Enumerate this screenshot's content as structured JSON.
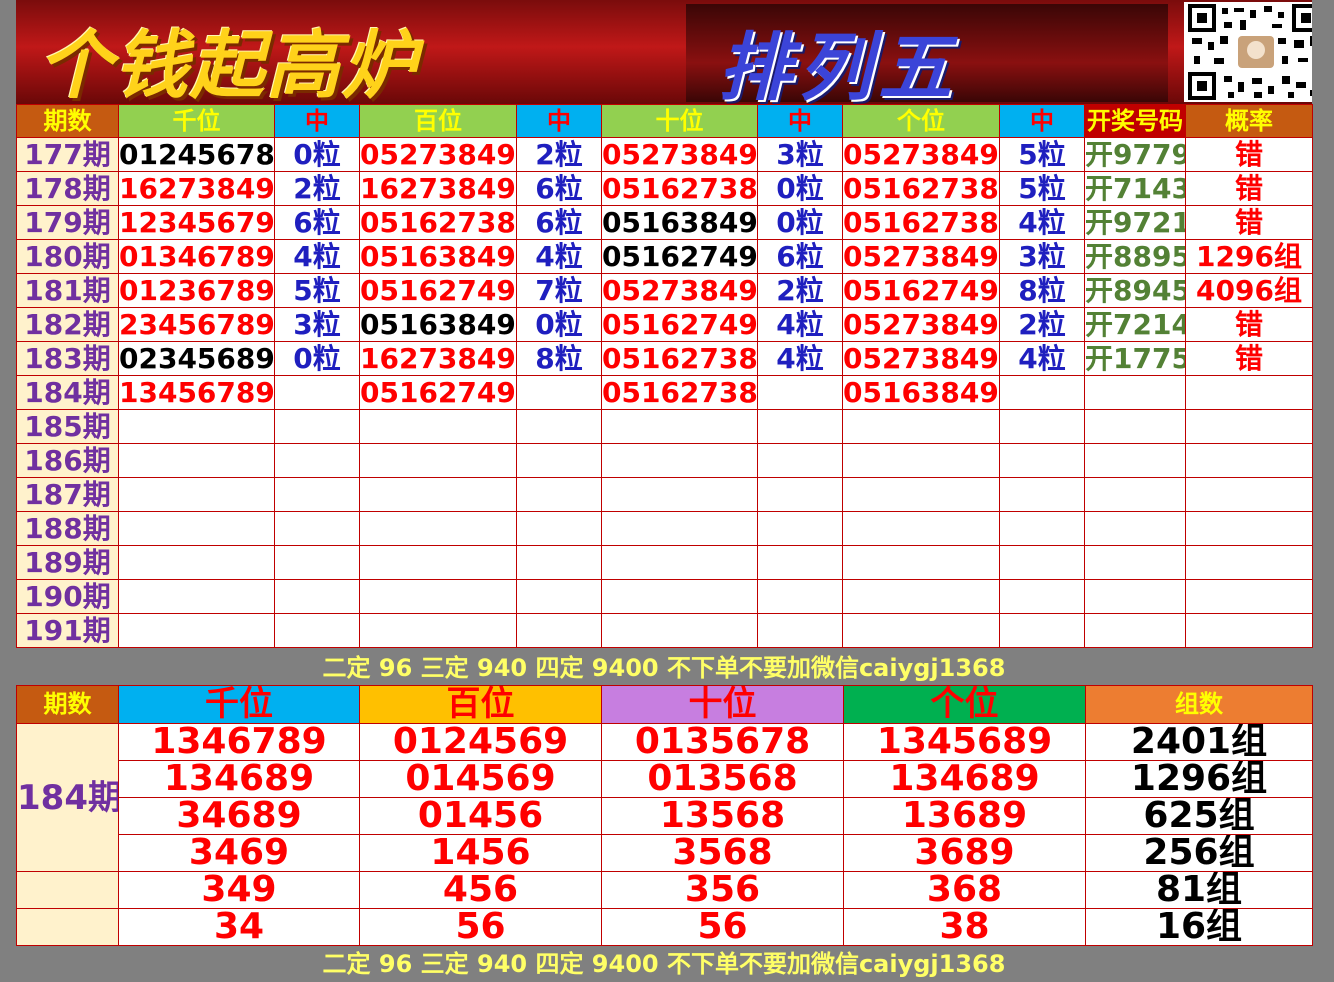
{
  "banner": {
    "title_left": "个钱起高炉",
    "title_right": "排列五",
    "qr_name": "wechat-qr-code"
  },
  "table1": {
    "headers": [
      "期数",
      "千位",
      "中",
      "百位",
      "中",
      "十位",
      "中",
      "个位",
      "中",
      "开奖号码",
      "概率"
    ],
    "rows": [
      {
        "period": "177期",
        "q": "01245678",
        "q_hit": "0粒",
        "b": "05273849",
        "b_hit": "2粒",
        "s": "05273849",
        "s_hit": "3粒",
        "g": "05273849",
        "g_hit": "5粒",
        "draw": "开9779",
        "rate": "错"
      },
      {
        "period": "178期",
        "q": "16273849",
        "q_hit": "2粒",
        "b": "16273849",
        "b_hit": "6粒",
        "s": "05162738",
        "s_hit": "0粒",
        "g": "05162738",
        "g_hit": "5粒",
        "draw": "开7143",
        "rate": "错"
      },
      {
        "period": "179期",
        "q": "12345679",
        "q_hit": "6粒",
        "b": "05162738",
        "b_hit": "6粒",
        "s": "05163849",
        "s_hit": "0粒",
        "g": "05162738",
        "g_hit": "4粒",
        "draw": "开9721",
        "rate": "错"
      },
      {
        "period": "180期",
        "q": "01346789",
        "q_hit": "4粒",
        "b": "05163849",
        "b_hit": "4粒",
        "s": "05162749",
        "s_hit": "6粒",
        "g": "05273849",
        "g_hit": "3粒",
        "draw": "开8895",
        "rate": "1296组"
      },
      {
        "period": "181期",
        "q": "01236789",
        "q_hit": "5粒",
        "b": "05162749",
        "b_hit": "7粒",
        "s": "05273849",
        "s_hit": "2粒",
        "g": "05162749",
        "g_hit": "8粒",
        "draw": "开8945",
        "rate": "4096组"
      },
      {
        "period": "182期",
        "q": "23456789",
        "q_hit": "3粒",
        "b": "05163849",
        "b_hit": "0粒",
        "s": "05162749",
        "s_hit": "4粒",
        "g": "05273849",
        "g_hit": "2粒",
        "draw": "开7214",
        "rate": "错"
      },
      {
        "period": "183期",
        "q": "02345689",
        "q_hit": "0粒",
        "b": "16273849",
        "b_hit": "8粒",
        "s": "05162738",
        "s_hit": "4粒",
        "g": "05273849",
        "g_hit": "4粒",
        "draw": "开1775",
        "rate": "错"
      },
      {
        "period": "184期",
        "q": "13456789",
        "q_hit": "",
        "b": "05162749",
        "b_hit": "",
        "s": "05162738",
        "s_hit": "",
        "g": "05163849",
        "g_hit": "",
        "draw": "",
        "rate": ""
      },
      {
        "period": "185期"
      },
      {
        "period": "186期"
      },
      {
        "period": "187期"
      },
      {
        "period": "188期"
      },
      {
        "period": "189期"
      },
      {
        "period": "190期"
      },
      {
        "period": "191期"
      }
    ]
  },
  "notice": "二定 96 三定 940 四定 9400 不下单不要加微信caiygj1368",
  "table2": {
    "headers": [
      "期数",
      "千位",
      "百位",
      "十位",
      "个位",
      "组数"
    ],
    "period": "184期",
    "rows": [
      [
        "1346789",
        "0124569",
        "0135678",
        "1345689",
        "2401组"
      ],
      [
        "134689",
        "014569",
        "013568",
        "134689",
        "1296组"
      ],
      [
        "34689",
        "01456",
        "13568",
        "13689",
        "625组"
      ],
      [
        "3469",
        "1456",
        "3568",
        "3689",
        "256组"
      ],
      [
        "349",
        "456",
        "356",
        "368",
        "81组"
      ],
      [
        "34",
        "56",
        "56",
        "38",
        "16组"
      ]
    ]
  },
  "colors": {
    "header_green": "#92d050",
    "header_blue": "#00b0f0",
    "red": "#ff0000",
    "hit_blue": "#1f1fbf",
    "draw_green": "#538135",
    "period_purple": "#7030a0"
  }
}
